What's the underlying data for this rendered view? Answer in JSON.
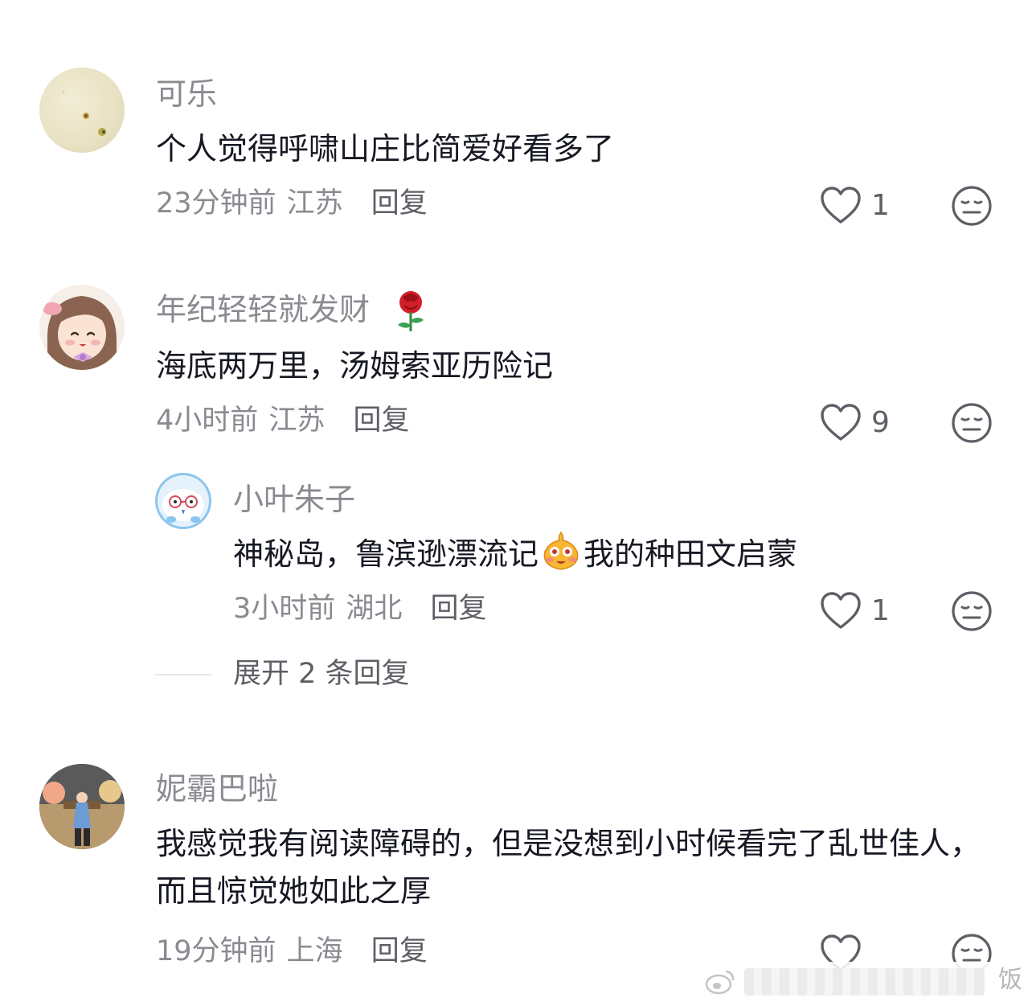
{
  "comments": [
    {
      "username": "可乐",
      "content": "个人觉得呼啸山庄比简爱好看多了",
      "time": "23分钟前",
      "location": "江苏",
      "reply_label": "回复",
      "likes": "1"
    },
    {
      "username": "年纪轻轻就发财",
      "username_emoji": "🌹",
      "content": "海底两万里，汤姆索亚历险记",
      "time": "4小时前",
      "location": "江苏",
      "reply_label": "回复",
      "likes": "9",
      "replies": [
        {
          "username": "小叶朱子",
          "content_before": "神秘岛，鲁滨逊漂流记",
          "content_emoji": "😳",
          "content_after": "我的种田文启蒙",
          "time": "3小时前",
          "location": "湖北",
          "reply_label": "回复",
          "likes": "1"
        }
      ],
      "expand_label": "展开 2 条回复"
    },
    {
      "username": "妮霸巴啦",
      "content": "我感觉我有阅读障碍的，但是没想到小时候看完了乱世佳人，而且惊觉她如此之厚",
      "time": "19分钟前",
      "location": "上海",
      "reply_label": "回复",
      "likes": ""
    }
  ],
  "watermark": {
    "text": "饭"
  },
  "icons": {
    "like": "heart-outline-icon",
    "dislike": "neutral-face-icon"
  }
}
